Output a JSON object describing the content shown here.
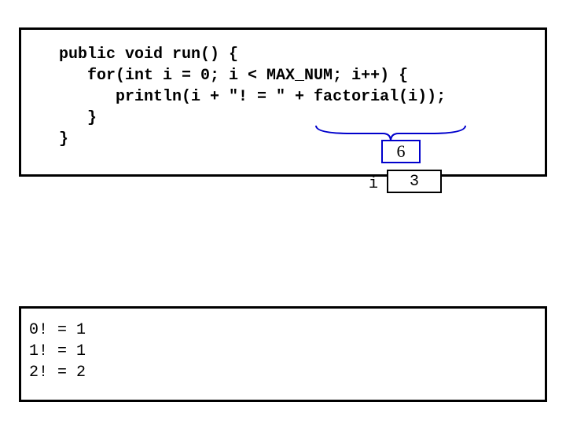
{
  "code": {
    "lines": [
      "   public void run() {",
      "      for(int i = 0; i < MAX_NUM; i++) {",
      "         println(i + \"! = \" + factorial(i));",
      "      }",
      "   }"
    ]
  },
  "annotation": {
    "bracket_value": "6",
    "var_name": "i",
    "var_value": "3"
  },
  "output": {
    "lines": [
      "0! = 1",
      "1! = 1",
      "2! = 2"
    ]
  }
}
